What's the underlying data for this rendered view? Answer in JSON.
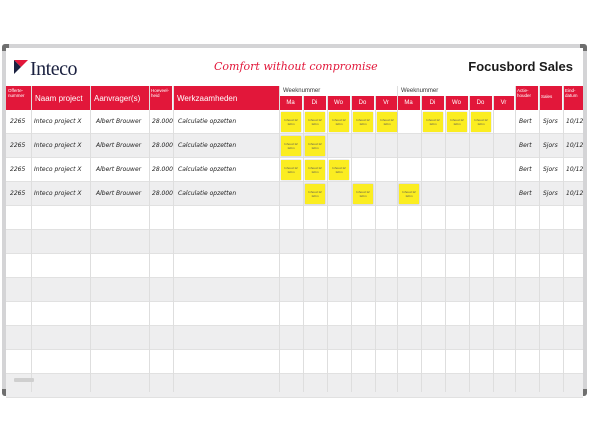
{
  "header": {
    "logo_text": "Inteco",
    "slogan": "Comfort without compromise",
    "board_title": "Focusbord Sales"
  },
  "columns": {
    "offerte": "Offerte-nummer",
    "naam_project": "Naam project",
    "aanvrager": "Aanvrager(s)",
    "hoeveelheid": "Hoeveel-heid",
    "werkzaamheden": "Werkzaamheden",
    "week1": "Weeknummer",
    "week2": "Weeknummer",
    "days": [
      "Ma",
      "Di",
      "Wo",
      "Do",
      "Vr"
    ],
    "actiehouder": "Actie-houder",
    "sales": "Sales",
    "einddatum": "Eind-datum"
  },
  "rows": [
    {
      "offerte": "2265",
      "naam": "Inteco project X",
      "aanvrager": "Albert Brouwer",
      "hoeveelheid": "28.000",
      "werk": "Calculatie opzetten",
      "actie": "Bert",
      "sales": "Sjors",
      "eind": "10/12"
    },
    {
      "offerte": "2265",
      "naam": "Inteco project X",
      "aanvrager": "Albert Brouwer",
      "hoeveelheid": "28.000",
      "werk": "Calculatie opzetten",
      "actie": "Bert",
      "sales": "Sjors",
      "eind": "10/12"
    },
    {
      "offerte": "2265",
      "naam": "Inteco project X",
      "aanvrager": "Albert Brouwer",
      "hoeveelheid": "28.000",
      "werk": "Calculatie opzetten",
      "actie": "Bert",
      "sales": "Sjors",
      "eind": "10/12"
    },
    {
      "offerte": "2265",
      "naam": "Inteco project X",
      "aanvrager": "Albert Brouwer",
      "hoeveelheid": "28.000",
      "werk": "Calculatie opzetten",
      "actie": "Bert",
      "sales": "Sjors",
      "eind": "10/12"
    }
  ],
  "sticky_text": "Inhoud 12\n12cm",
  "colors": {
    "accent": "#e2173a",
    "sticky": "#fbed21",
    "frame": "#d4d4d6"
  }
}
